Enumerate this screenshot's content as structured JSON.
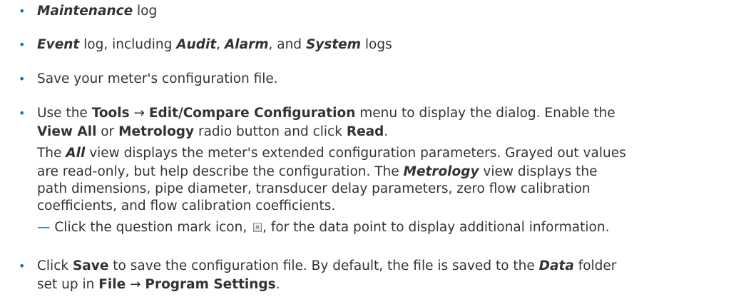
{
  "bullets": [
    {
      "lines": [
        [
          {
            "t": "Maintenance",
            "s": "bi"
          },
          {
            "t": " log",
            "s": ""
          }
        ]
      ]
    },
    {
      "lines": [
        [
          {
            "t": "Event",
            "s": "bi"
          },
          {
            "t": " log, including ",
            "s": ""
          },
          {
            "t": "Audit",
            "s": "bi"
          },
          {
            "t": ", ",
            "s": ""
          },
          {
            "t": "Alarm",
            "s": "bi"
          },
          {
            "t": ", and ",
            "s": ""
          },
          {
            "t": "System",
            "s": "bi"
          },
          {
            "t": " logs",
            "s": ""
          }
        ]
      ]
    },
    {
      "lines": [
        [
          {
            "t": "Save your meter's configuration file.",
            "s": ""
          }
        ]
      ]
    },
    {
      "lines": [
        [
          {
            "t": "Use the ",
            "s": ""
          },
          {
            "t": "Tools",
            "s": "b"
          },
          {
            "t": " → ",
            "s": ""
          },
          {
            "t": "Edit/Compare Configuration",
            "s": "b"
          },
          {
            "t": " menu to display the dialog. Enable the",
            "s": ""
          }
        ],
        [
          {
            "t": "View All",
            "s": "b"
          },
          {
            "t": " or ",
            "s": ""
          },
          {
            "t": "Metrology",
            "s": "b"
          },
          {
            "t": " radio button and click ",
            "s": ""
          },
          {
            "t": "Read",
            "s": "b"
          },
          {
            "t": ".",
            "s": ""
          }
        ],
        [
          {
            "t": "The ",
            "s": ""
          },
          {
            "t": "All",
            "s": "bi"
          },
          {
            "t": " view displays the meter's extended configuration parameters. Grayed out values",
            "s": ""
          }
        ],
        [
          {
            "t": "are read-only, but help describe the configuration. The ",
            "s": ""
          },
          {
            "t": "Metrology",
            "s": "bi"
          },
          {
            "t": " view displays the",
            "s": ""
          }
        ],
        [
          {
            "t": "path dimensions, pipe diameter, transducer delay parameters, zero flow calibration",
            "s": ""
          }
        ],
        [
          {
            "t": "coefficients, and flow calibration coefficients.",
            "s": ""
          }
        ],
        [
          {
            "t": "— ",
            "s": "dash"
          },
          {
            "t": "Click the question mark icon, ",
            "s": ""
          },
          {
            "t": "",
            "s": "icon",
            "icon": "question-mark-icon"
          },
          {
            "t": ", for the data point to display additional information.",
            "s": ""
          }
        ]
      ]
    },
    {
      "lines": [
        [
          {
            "t": "Click ",
            "s": ""
          },
          {
            "t": "Save",
            "s": "b"
          },
          {
            "t": " to save the configuration file. By default, the file is saved to the ",
            "s": ""
          },
          {
            "t": "Data",
            "s": "bi"
          },
          {
            "t": " folder",
            "s": ""
          }
        ],
        [
          {
            "t": "set up in ",
            "s": ""
          },
          {
            "t": "File",
            "s": "b"
          },
          {
            "t": " → ",
            "s": ""
          },
          {
            "t": "Program Settings",
            "s": "b"
          },
          {
            "t": ".",
            "s": ""
          }
        ]
      ]
    }
  ],
  "bullet_glyph": "•",
  "colors": {
    "text": "#333333",
    "bullet": "#0078c8"
  }
}
